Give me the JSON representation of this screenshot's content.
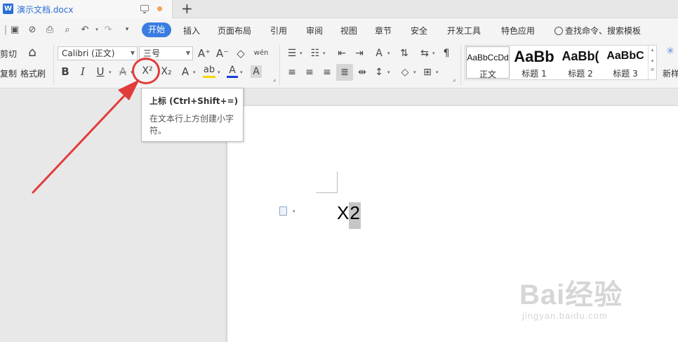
{
  "window": {
    "doc_tab_title": "演示文档.docx",
    "app_logo_letter": "W",
    "new_tab_symbol": "+"
  },
  "menu": {
    "quick_access": [
      "save-icon",
      "cloud-icon",
      "print-icon",
      "preview-icon",
      "undo-icon",
      "redo-icon",
      "more-icon"
    ],
    "active_tab": "开始",
    "tabs": [
      "插入",
      "页面布局",
      "引用",
      "审阅",
      "视图",
      "章节",
      "安全",
      "开发工具",
      "特色应用"
    ],
    "search_placeholder": "查找命令、搜索模板"
  },
  "ribbon": {
    "clipboard": {
      "cut": "剪切",
      "copy": "复制",
      "format_painter": "格式刷"
    },
    "font_name": "Calibri (正文)",
    "font_size": "三号",
    "grow_font": "A⁺",
    "shrink_font": "A⁻",
    "clear_format": "◇",
    "phonetic": "wén",
    "bold": "B",
    "italic": "I",
    "underline": "U",
    "strikethrough": "A",
    "superscript": "X²",
    "subscript": "X₂",
    "text_effect": "A",
    "highlight": "ab",
    "font_color": "A",
    "char_shading": "A",
    "styles": [
      {
        "sample": "AaBbCcDd",
        "label": "正文"
      },
      {
        "sample": "AaBb",
        "label": "标题 1"
      },
      {
        "sample": "AaBb(",
        "label": "标题 2"
      },
      {
        "sample": "AaBbC",
        "label": "标题 3"
      }
    ],
    "new_style": "新样"
  },
  "tooltip": {
    "title": "上标 (Ctrl+Shift+=)",
    "description": "在文本行上方创建小字符。"
  },
  "document": {
    "text_main": "X",
    "text_selected": "2"
  },
  "watermark": {
    "big": "Bai经验",
    "small": "jingyan.baidu.com"
  },
  "colors": {
    "accent": "#3a7de0",
    "annotation": "#e23b3b",
    "highlight_yellow": "#f5d800",
    "font_color_blue": "#1a3fd6"
  }
}
